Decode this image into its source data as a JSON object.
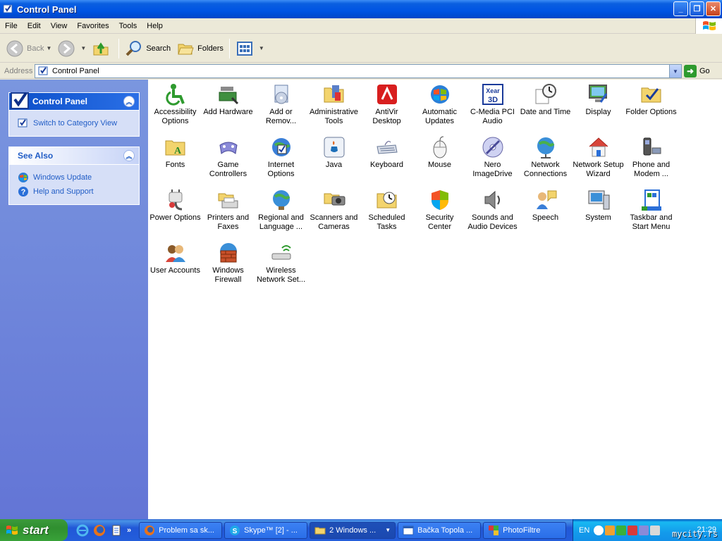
{
  "window": {
    "title": "Control Panel"
  },
  "menu": [
    "File",
    "Edit",
    "View",
    "Favorites",
    "Tools",
    "Help"
  ],
  "toolbar": {
    "back": "Back",
    "search": "Search",
    "folders": "Folders"
  },
  "address": {
    "label": "Address",
    "value": "Control Panel",
    "go": "Go"
  },
  "sidebar": {
    "control_panel": {
      "title": "Control Panel",
      "links": [
        "Switch to Category View"
      ]
    },
    "see_also": {
      "title": "See Also",
      "links": [
        "Windows Update",
        "Help and Support"
      ]
    }
  },
  "items": [
    "Accessibility Options",
    "Add Hardware",
    "Add or Remov...",
    "Administrative Tools",
    "AntiVir Desktop",
    "Automatic Updates",
    "C-Media PCI Audio",
    "Date and Time",
    "Display",
    "Folder Options",
    "Fonts",
    "Game Controllers",
    "Internet Options",
    "Java",
    "Keyboard",
    "Mouse",
    "Nero ImageDrive",
    "Network Connections",
    "Network Setup Wizard",
    "Phone and Modem ...",
    "Power Options",
    "Printers and Faxes",
    "Regional and Language ...",
    "Scanners and Cameras",
    "Scheduled Tasks",
    "Security Center",
    "Sounds and Audio Devices",
    "Speech",
    "System",
    "Taskbar and Start Menu",
    "User Accounts",
    "Windows Firewall",
    "Wireless Network Set..."
  ],
  "taskbar": {
    "start": "start",
    "more": "»",
    "tasks": [
      "Problem sa sk...",
      "Skype™ [2] - ...",
      "2 Windows ...",
      "Bačka Topola ...",
      "PhotoFiltre"
    ],
    "lang": "EN",
    "clock": "21:29",
    "watermark": "mycity.rs"
  }
}
